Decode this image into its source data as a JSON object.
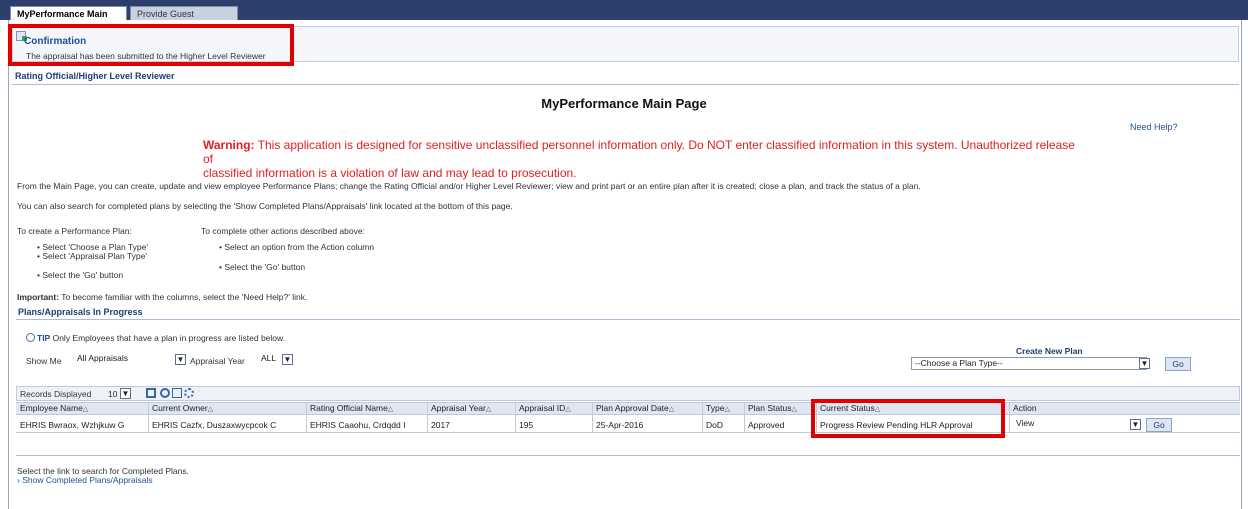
{
  "tabs": [
    {
      "label": "MyPerformance Main Page",
      "active": true
    },
    {
      "label": "Provide Guest Feedback",
      "active": false
    }
  ],
  "confirmation": {
    "title": "Confirmation",
    "message": "The appraisal has been submitted to the Higher Level Reviewer"
  },
  "section_role": "Rating Official/Higher Level Reviewer",
  "page_title": "MyPerformance Main Page",
  "need_help": "Need Help?",
  "warning": {
    "label": "Warning:",
    "line1": " This application is designed for sensitive unclassified personnel information only. Do NOT enter classified information in this system. Unauthorized release of",
    "line2": "classified information is a violation of law and may lead to prosecution."
  },
  "intro": {
    "p1": "From the Main Page, you can create, update and view employee Performance Plans; change the Rating Official and/or Higher Level Reviewer; view and print part or an entire plan after it is created; close a plan, and track the status of a plan.",
    "p2": "You can also search for completed plans by selecting the 'Show Completed Plans/Appraisals' link located at the bottom of this page."
  },
  "instructions": {
    "create_heading": "To create a Performance Plan:",
    "create_steps": [
      "• Select 'Choose a Plan Type'",
      "• Select 'Appraisal Plan Type'",
      "• Select the 'Go' button"
    ],
    "other_heading": "To complete other actions described above:",
    "other_steps": [
      "• Select an option from the Action column",
      "• Select the 'Go' button"
    ]
  },
  "important": {
    "label": "Important:",
    "text": " To become familiar with the columns, select the 'Need Help?' link."
  },
  "plans_section": "Plans/Appraisals In Progress",
  "tip": {
    "label": "TIP",
    "text": " Only Employees that have a plan in progress are listed below."
  },
  "filters": {
    "show_me_label": "Show Me",
    "show_me_value": "All Appraisals",
    "year_label": "Appraisal Year",
    "year_value": "ALL"
  },
  "create_plan": {
    "heading": "Create New Plan",
    "select_value": "--Choose a Plan Type--",
    "go": "Go"
  },
  "records": {
    "label": "Records Displayed",
    "value": "10"
  },
  "table": {
    "headers": [
      "Employee Name",
      "Current Owner",
      "Rating Official Name",
      "Appraisal Year",
      "Appraisal ID",
      "Plan Approval Date",
      "Type",
      "Plan Status",
      "Current Status",
      "Action"
    ],
    "sort_glyph": "△",
    "rows": [
      {
        "employee": "EHRIS Bwraox, Wzhjkuw G",
        "owner": "EHRIS Cazfx, Duszaxwycpcok C",
        "rating_official": "EHRIS Caaohu, Crdqdd I",
        "year": "2017",
        "id": "195",
        "approval_date": "25-Apr-2016",
        "type": "DoD",
        "plan_status": "Approved",
        "current_status": "Progress Review Pending HLR Approval",
        "action": "View",
        "go": "Go"
      }
    ]
  },
  "footer": {
    "text": "Select the link to search for Completed Plans.",
    "link": "Show Completed Plans/Appraisals"
  },
  "colors": {
    "header_bar": "#2d3f6a",
    "warning": "#e41e1e",
    "highlight": "#e00000",
    "link": "#1f4f9a"
  }
}
